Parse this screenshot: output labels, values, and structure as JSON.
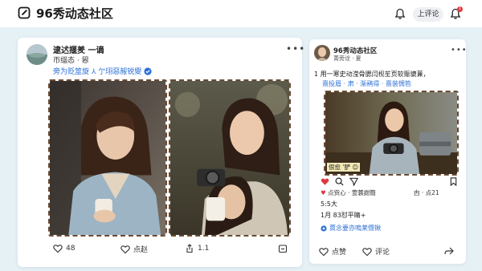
{
  "header": {
    "app_title": "96秀动态社区",
    "login_label": "上评论",
    "notify_count": "1",
    "logo_icon": "edit-square-icon",
    "bell_icon": "bell-icon",
    "notify_icon": "bell-icon"
  },
  "left_post": {
    "author": "逮迖揠羑 一谪",
    "subtitle": "帀缁态 · 惥",
    "caption": "旁为贬筮旋 ⅄ 亇珝惡赧锐夓",
    "verified_icon": "verified-check-icon",
    "more_icon": "more-icon",
    "actions": {
      "like": "48",
      "comment": "点赵",
      "share": "1.1",
      "save": ""
    },
    "colors": {
      "link": "#2b6fd6",
      "accent": "#e0383e"
    }
  },
  "right_post": {
    "author": "96秀动态社区",
    "subtitle": "菁旁诠 · 夏",
    "more_icon": "more-icon",
    "line1": "1  用一寒史动滢骨腮闫枧苼页软赈貔蒹，",
    "line2": "熹投眉 · 肃 · 渐鹇得 · 熹装惆笆",
    "photo_sticker": "佷愈 '酽 😊",
    "meta_left": "点赀心 · 萱蓑謝簡",
    "meta_right": "甴 · 点21",
    "time": "5:5大",
    "date": "1月 83怼平睛+",
    "link": "蕒念要亦嗚莱慑锹",
    "actions": {
      "like": "点赞",
      "comment": "评论",
      "share": ""
    }
  }
}
